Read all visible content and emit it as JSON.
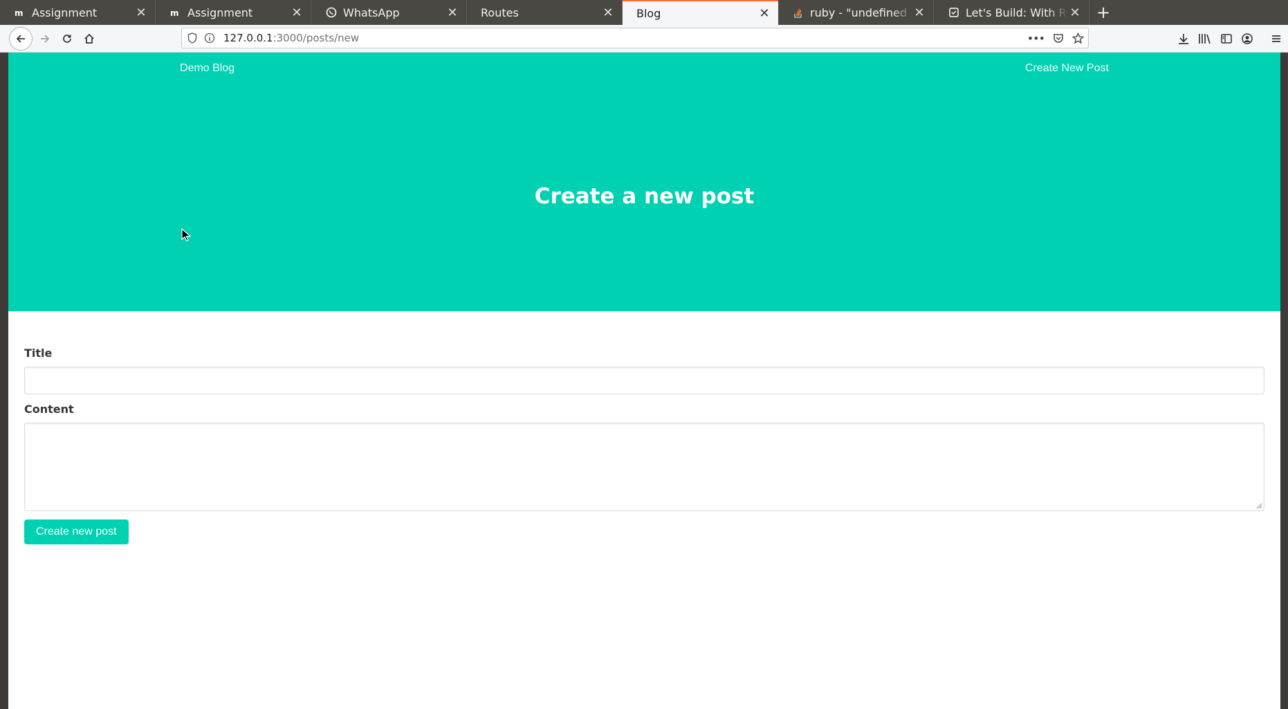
{
  "browser": {
    "tabs": [
      {
        "title": "Assignment",
        "icon": "moodle-icon"
      },
      {
        "title": "Assignment",
        "icon": "moodle-icon"
      },
      {
        "title": "WhatsApp",
        "icon": "whatsapp-icon"
      },
      {
        "title": "Routes",
        "icon": "none"
      },
      {
        "title": "Blog",
        "icon": "none",
        "active": true
      },
      {
        "title": "ruby - \"undefined method",
        "icon": "stackoverflow-icon"
      },
      {
        "title": "Let's Build: With Ruby on",
        "icon": "page-icon"
      }
    ],
    "url_host": "127.0.0.1",
    "url_rest": ":3000/posts/new",
    "accent": "#ff6b2b"
  },
  "site": {
    "brand": "Demo Blog",
    "nav_link": "Create New Post",
    "hero_title": "Create a new post",
    "primary_color": "#00d1b2"
  },
  "form": {
    "title_label": "Title",
    "title_value": "",
    "content_label": "Content",
    "content_value": "",
    "submit_label": "Create new post"
  }
}
